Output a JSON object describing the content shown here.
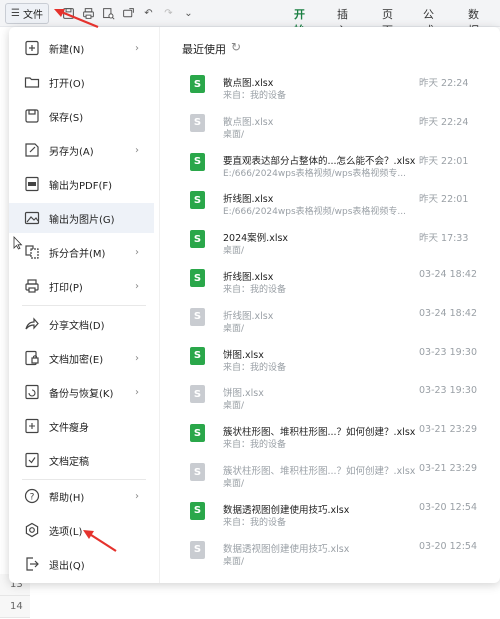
{
  "toolbar": {
    "file_label": "文件",
    "tabs": [
      "开始",
      "插入",
      "页面",
      "公式",
      "数据"
    ]
  },
  "menu": {
    "items": [
      {
        "label": "新建(N)",
        "icon": "new-doc-icon",
        "arrow": true
      },
      {
        "label": "打开(O)",
        "icon": "folder-open-icon",
        "arrow": false
      },
      {
        "label": "保存(S)",
        "icon": "save-icon",
        "arrow": false
      },
      {
        "label": "另存为(A)",
        "icon": "save-as-icon",
        "arrow": true
      },
      {
        "label": "输出为PDF(F)",
        "icon": "pdf-export-icon",
        "arrow": false
      },
      {
        "label": "输出为图片(G)",
        "icon": "image-export-icon",
        "arrow": false
      },
      {
        "label": "拆分合并(M)",
        "icon": "split-merge-icon",
        "arrow": true
      },
      {
        "label": "打印(P)",
        "icon": "print-icon",
        "arrow": true
      },
      {
        "label": "分享文档(D)",
        "icon": "share-icon",
        "arrow": false
      },
      {
        "label": "文档加密(E)",
        "icon": "encrypt-icon",
        "arrow": true
      },
      {
        "label": "备份与恢复(K)",
        "icon": "backup-icon",
        "arrow": true
      },
      {
        "label": "文件瘦身",
        "icon": "slim-icon",
        "arrow": false
      },
      {
        "label": "文档定稿",
        "icon": "finalize-icon",
        "arrow": false
      },
      {
        "label": "帮助(H)",
        "icon": "help-icon",
        "arrow": true
      },
      {
        "label": "选项(L)",
        "icon": "options-gear-icon",
        "arrow": false
      },
      {
        "label": "退出(Q)",
        "icon": "exit-icon",
        "arrow": false
      }
    ]
  },
  "recent": {
    "title": "最近使用",
    "files": [
      {
        "name": "散点图.xlsx",
        "path": "来自：我的设备",
        "time": "昨天 22:24",
        "active": true
      },
      {
        "name": "散点图.xlsx",
        "path": "桌面/",
        "time": "昨天 22:24",
        "active": false
      },
      {
        "name": "要直观表达部分占整体的...怎么能不会？.xlsx",
        "path": "E:/666/2024wps表格视频/wps表格视频专...",
        "time": "昨天 22:01",
        "active": true
      },
      {
        "name": "折线图.xlsx",
        "path": "E:/666/2024wps表格视频/wps表格视频专...",
        "time": "昨天 22:01",
        "active": true
      },
      {
        "name": "2024案例.xlsx",
        "path": "桌面/",
        "time": "昨天 17:33",
        "active": true
      },
      {
        "name": "折线图.xlsx",
        "path": "来自：我的设备",
        "time": "03-24 18:42",
        "active": true
      },
      {
        "name": "折线图.xlsx",
        "path": "桌面/",
        "time": "03-24 18:42",
        "active": false
      },
      {
        "name": "饼图.xlsx",
        "path": "来自：我的设备",
        "time": "03-23 19:30",
        "active": true
      },
      {
        "name": "饼图.xlsx",
        "path": "桌面/",
        "time": "03-23 19:30",
        "active": false
      },
      {
        "name": "簇状柱形图、堆积柱形图...？如何创建？.xlsx",
        "path": "来自：我的设备",
        "time": "03-21 23:29",
        "active": true
      },
      {
        "name": "簇状柱形图、堆积柱形图...？如何创建？.xlsx",
        "path": "桌面/",
        "time": "03-21 23:29",
        "active": false
      },
      {
        "name": "数据透视图创建使用技巧.xlsx",
        "path": "来自：我的设备",
        "time": "03-20 12:54",
        "active": true
      },
      {
        "name": "数据透视图创建使用技巧.xlsx",
        "path": "桌面/",
        "time": "03-20 12:54",
        "active": false
      }
    ]
  },
  "sheet": {
    "row_numbers": [
      "13",
      "14"
    ]
  },
  "colors": {
    "accent_green": "#1b7f43",
    "file_icon_green": "#2aa74a",
    "annotation_red": "#e5322d"
  }
}
